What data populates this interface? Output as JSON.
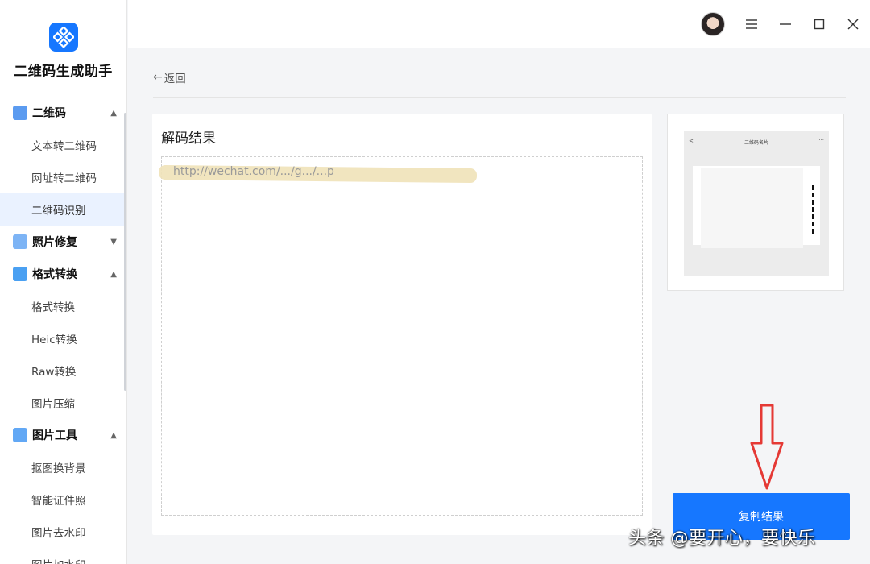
{
  "app": {
    "name": "二维码生成助手"
  },
  "sidebar": {
    "groups": [
      {
        "label": "二维码",
        "expanded": true,
        "icon_color": "#5b9bf0",
        "items": [
          "文本转二维码",
          "网址转二维码",
          "二维码识别"
        ]
      },
      {
        "label": "照片修复",
        "expanded": false,
        "icon_color": "#7db4f5",
        "items": []
      },
      {
        "label": "格式转换",
        "expanded": true,
        "icon_color": "#4aa0f2",
        "items": [
          "格式转换",
          "Heic转换",
          "Raw转换",
          "图片压缩"
        ]
      },
      {
        "label": "图片工具",
        "expanded": true,
        "icon_color": "#62a8f5",
        "items": [
          "抠图换背景",
          "智能证件照",
          "图片去水印",
          "图片加水印"
        ]
      }
    ],
    "active_item": "二维码识别"
  },
  "content": {
    "back_label": "返回",
    "result_title": "解码结果",
    "result_text": "http://wechat.com/.../g.../...p",
    "copy_button": "复制结果",
    "preview": {
      "mini_title": "二维码名片"
    }
  },
  "colors": {
    "accent": "#1677ff",
    "active_bg": "#eaf2ff",
    "annotation_arrow": "#e53935"
  },
  "watermark": "头条 @要开心，要快乐"
}
